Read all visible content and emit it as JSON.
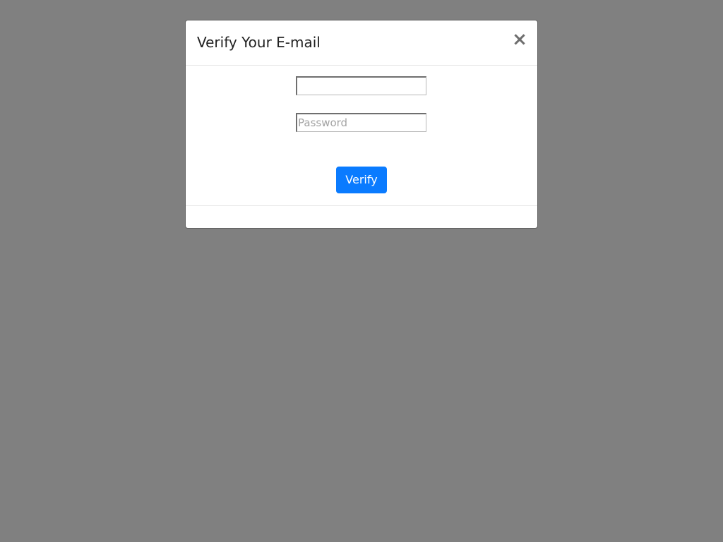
{
  "dialog": {
    "title": "Verify Your E-mail",
    "close_label": "×",
    "close_icon": "close-icon"
  },
  "form": {
    "email": {
      "value": "",
      "placeholder": ""
    },
    "password": {
      "value": "",
      "placeholder": "Password"
    },
    "submit_label": "Verify"
  },
  "colors": {
    "backdrop": "#808080",
    "dialog_background": "#ffffff",
    "primary_button": "#0a7bff",
    "button_text": "#ffffff",
    "title_text": "#222222",
    "placeholder_text": "#a3a3a3"
  }
}
